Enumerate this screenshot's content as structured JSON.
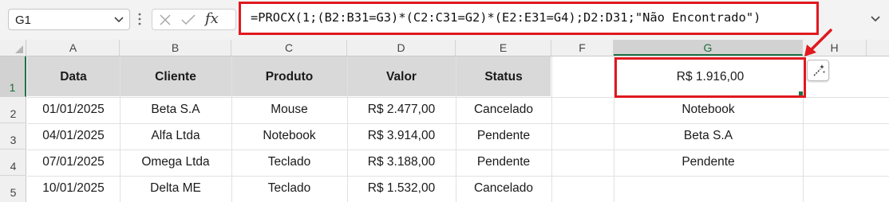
{
  "formula_bar": {
    "name_box": "G1",
    "insert_function_label": "fx",
    "formula": "=PROCX(1;(B2:B31=G3)*(C2:C31=G2)*(E2:E31=G4);D2:D31;\"Não Encontrado\")"
  },
  "columns": [
    "A",
    "B",
    "C",
    "D",
    "E",
    "F",
    "G",
    "H"
  ],
  "rows": [
    "1",
    "2",
    "3",
    "4",
    "5"
  ],
  "table": {
    "headers": [
      "Data",
      "Cliente",
      "Produto",
      "Valor",
      "Status"
    ],
    "data": [
      [
        "01/01/2025",
        "Beta S.A",
        "Mouse",
        "R$ 2.477,00",
        "Cancelado"
      ],
      [
        "04/01/2025",
        "Alfa Ltda",
        "Notebook",
        "R$ 3.914,00",
        "Pendente"
      ],
      [
        "07/01/2025",
        "Omega Ltda",
        "Teclado",
        "R$ 3.188,00",
        "Pendente"
      ],
      [
        "10/01/2025",
        "Delta ME",
        "Teclado",
        "R$ 1.532,00",
        "Cancelado"
      ]
    ]
  },
  "lookup": {
    "result": "R$ 1.916,00",
    "criteria": [
      "Notebook",
      "Beta S.A",
      "Pendente"
    ]
  },
  "colors": {
    "highlight": "#e0191f",
    "header_fill": "#d9d9d9",
    "selection_green": "#1e7145"
  }
}
